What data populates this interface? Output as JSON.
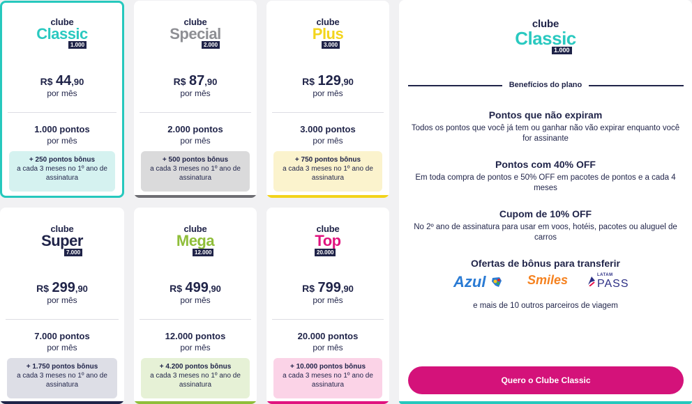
{
  "plans": [
    {
      "prefix": "clube",
      "name": "Classic",
      "tier": "1.000",
      "currency": "R$",
      "price_int": "44",
      "price_cents": ",90",
      "per": "por mês",
      "points": "1.000 pontos",
      "points_per": "por mês",
      "bonus_title": "+ 250 pontos bônus",
      "bonus_text": "a cada 3 meses no 1º ano de assinatura",
      "name_color": "#2ac9c0",
      "bonus_bg": "#d5f2f0",
      "bar_color": "#26c8bd"
    },
    {
      "prefix": "clube",
      "name": "Special",
      "tier": "2.000",
      "currency": "R$",
      "price_int": "87",
      "price_cents": ",90",
      "per": "por mês",
      "points": "2.000 pontos",
      "points_per": "por mês",
      "bonus_title": "+ 500 pontos bônus",
      "bonus_text": "a cada 3 meses no 1º ano de assinatura",
      "name_color": "#8e8f94",
      "bonus_bg": "#dadadb",
      "bar_color": "#6d6d72"
    },
    {
      "prefix": "clube",
      "name": "Plus",
      "tier": "3.000",
      "currency": "R$",
      "price_int": "129",
      "price_cents": ",90",
      "per": "por mês",
      "points": "3.000 pontos",
      "points_per": "por mês",
      "bonus_title": "+ 750 pontos bônus",
      "bonus_text": "a cada 3 meses no 1º ano de assinatura",
      "name_color": "#f3d51d",
      "bonus_bg": "#fbf3cd",
      "bar_color": "#f2d31b"
    },
    {
      "prefix": "clube",
      "name": "Super",
      "tier": "7.000",
      "currency": "R$",
      "price_int": "299",
      "price_cents": ",90",
      "per": "por mês",
      "points": "7.000 pontos",
      "points_per": "por mês",
      "bonus_title": "+ 1.750 pontos bônus",
      "bonus_text": "a cada 3 meses no 1º ano de assinatura",
      "name_color": "#1f2348",
      "bonus_bg": "#dddee6",
      "bar_color": "#1f2348"
    },
    {
      "prefix": "clube",
      "name": "Mega",
      "tier": "12.000",
      "currency": "R$",
      "price_int": "499",
      "price_cents": ",90",
      "per": "por mês",
      "points": "12.000 pontos",
      "points_per": "por mês",
      "bonus_title": "+ 4.200 pontos bônus",
      "bonus_text": "a cada 3 meses no 1º ano de assinatura",
      "name_color": "#8fbe3a",
      "bonus_bg": "#e6f1d6",
      "bar_color": "#8fbe3a"
    },
    {
      "prefix": "clube",
      "name": "Top",
      "tier": "20.000",
      "currency": "R$",
      "price_int": "799",
      "price_cents": ",90",
      "per": "por mês",
      "points": "20.000 pontos",
      "points_per": "por mês",
      "bonus_title": "+ 10.000 pontos bônus",
      "bonus_text": "a cada 3 meses no 1º ano de assinatura",
      "name_color": "#e0147f",
      "bonus_bg": "#fbd3e7",
      "bar_color": "#e0147f"
    }
  ],
  "detail": {
    "prefix": "clube",
    "name": "Classic",
    "tier": "1.000",
    "name_color": "#2ac9c0",
    "section_title": "Benefícios do plano",
    "benefits": [
      {
        "title": "Pontos que não expiram",
        "text": "Todos os pontos que você já tem ou ganhar não vão expirar enquanto você for assinante"
      },
      {
        "title": "Pontos com 40% OFF",
        "text": "Em toda compra de pontos e 50% OFF em pacotes de pontos e a cada 4 meses"
      },
      {
        "title": "Cupom de 10% OFF",
        "text": "No 2º ano de assinatura para usar em voos, hotéis, pacotes ou aluguel de carros"
      }
    ],
    "partners_title": "Ofertas de bônus para transferir",
    "partners": [
      {
        "name": "Azul",
        "color": "#2a7bd4"
      },
      {
        "name": "Smiles",
        "color": "#f58220"
      },
      {
        "name": "PASS",
        "prefix": "LATAM",
        "color": "#2b2e84"
      }
    ],
    "more_partners": "e mais de 10 outros parceiros de viagem",
    "cta_label": "Quero o Clube Classic",
    "cta_color": "#d4127a"
  }
}
